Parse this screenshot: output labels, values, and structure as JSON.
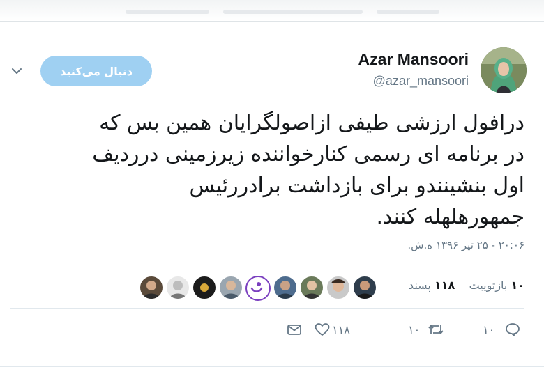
{
  "colors": {
    "accent": "#1da1f2",
    "follow_bg": "#9fd0f2",
    "text": "#14171a",
    "muted": "#657786"
  },
  "header": {
    "follow_label": "دنبال می‌کنید",
    "display_name": "Azar Mansoori",
    "handle": "@azar_mansoori"
  },
  "tweet": {
    "lines": [
      "درافول ارزشی طیفی ازاصولگرایان همین بس که",
      "در برنامه ای رسمی کنارخواننده زیرزمینی درردیف",
      "اول بنشینندو برای بازداشت برادررئیس",
      "جمهورهلهله کنند."
    ],
    "timestamp": "۲۰:۰۶ - ۲۵ تیر ۱۳۹۶ ه.ش."
  },
  "stats": {
    "retweet_count": "۱۰",
    "retweet_label": "بازتوییت",
    "like_count": "۱۱۸",
    "like_label": "پسند"
  },
  "actions": {
    "reply_count": "۱۰",
    "retweet_count": "۱۰",
    "like_count": "۱۱۸"
  }
}
